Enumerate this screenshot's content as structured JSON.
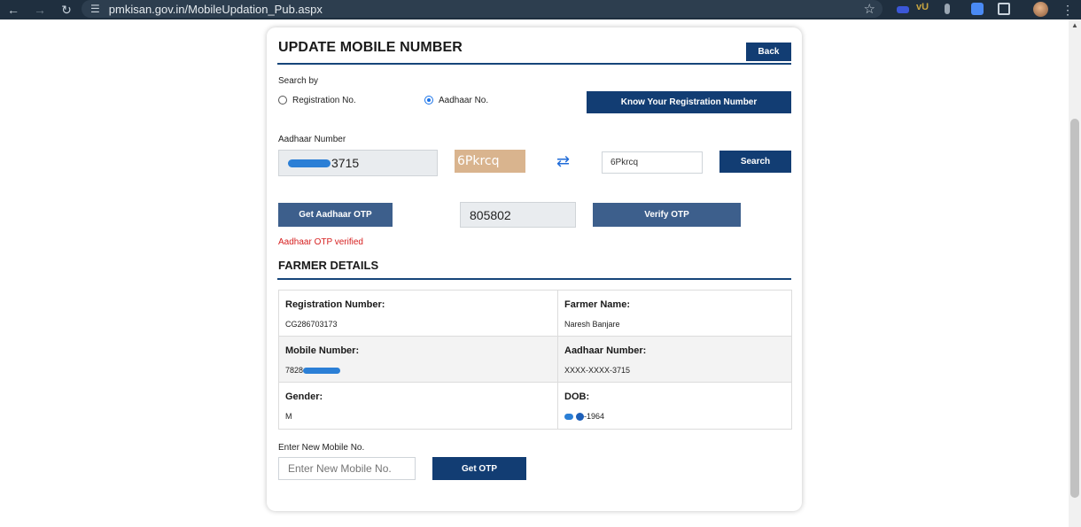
{
  "browser": {
    "url": "pmkisan.gov.in/MobileUpdation_Pub.aspx",
    "ext_label": "vU"
  },
  "page": {
    "title": "UPDATE MOBILE NUMBER",
    "back_label": "Back",
    "search_by_label": "Search by",
    "radio_registration": "Registration No.",
    "radio_aadhaar": "Aadhaar No.",
    "selected_search": "Aadhaar No.",
    "know_reg_button": "Know Your Registration Number",
    "aadhaar_number_label": "Aadhaar Number",
    "aadhaar_visible_suffix": "3715",
    "captcha_text": "6Pkrcq",
    "captcha_input_value": "6Pkrcq",
    "search_button": "Search",
    "get_aadhaar_otp_button": "Get Aadhaar OTP",
    "otp_value": "805802",
    "verify_otp_button": "Verify OTP",
    "otp_status": "Aadhaar OTP verified",
    "farmer_details_title": "FARMER DETAILS",
    "details": [
      {
        "left_label": "Registration Number:",
        "left_value": "CG286703173",
        "right_label": "Farmer Name:",
        "right_value": "Naresh Banjare"
      },
      {
        "left_label": "Mobile Number:",
        "left_value": "7828",
        "right_label": "Aadhaar Number:",
        "right_value": "XXXX-XXXX-3715"
      },
      {
        "left_label": "Gender:",
        "left_value": "M",
        "right_label": "DOB:",
        "right_value": "-1964"
      }
    ],
    "new_mobile_label": "Enter New Mobile No.",
    "new_mobile_placeholder": "Enter New Mobile No.",
    "get_otp_button": "Get OTP"
  },
  "colors": {
    "primary_dark": "#123d73",
    "primary_mid": "#3d5f8c",
    "error_red": "#d61f1f",
    "captcha_bg": "#d9b48e",
    "redaction_blue": "#2b7fd6"
  },
  "icons": {
    "back": "arrow-left-icon",
    "forward": "arrow-right-icon",
    "reload": "reload-icon",
    "site_settings": "tune-icon",
    "bookmark": "star-icon",
    "captcha_refresh": "refresh-icon",
    "menu": "kebab-menu-icon"
  }
}
